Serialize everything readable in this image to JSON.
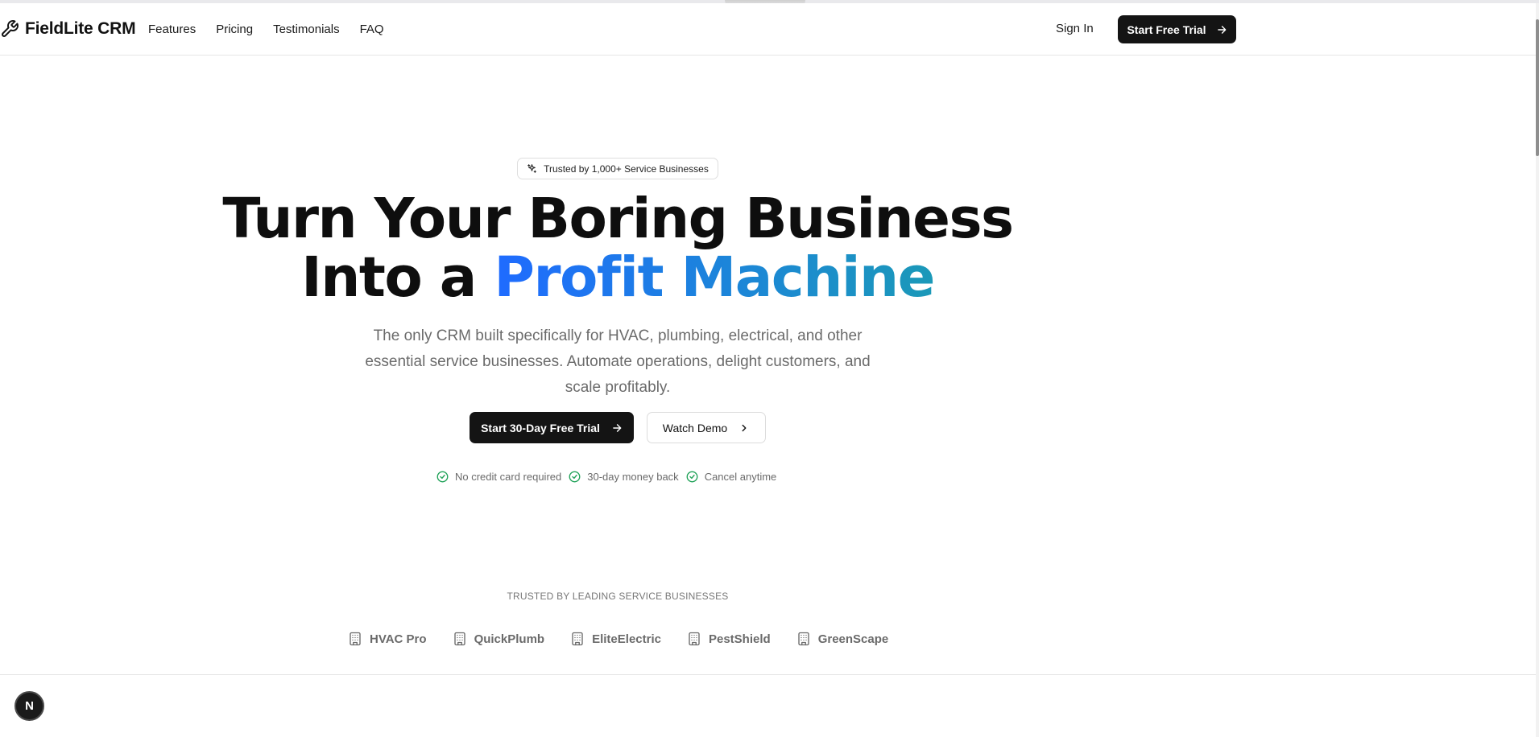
{
  "header": {
    "brand_name": "FieldLite CRM",
    "brand_icon": "wrench-icon",
    "nav_links": [
      "Features",
      "Pricing",
      "Testimonials",
      "FAQ"
    ],
    "sign_in_label": "Sign In",
    "cta_label": "Start Free Trial"
  },
  "hero": {
    "badge_text": "Trusted by 1,000+ Service Businesses",
    "headline_line1": "Turn Your Boring Business",
    "headline_line2_prefix": "Into a ",
    "headline_highlight": "Profit Machine",
    "subtext": "The only CRM built specifically for HVAC, plumbing, electrical, and other essential service businesses. Automate operations, delight customers, and scale profitably.",
    "primary_cta": "Start 30-Day Free Trial",
    "secondary_cta": "Watch Demo",
    "checks": [
      "No credit card required",
      "30-day money back",
      "Cancel anytime"
    ]
  },
  "trusted": {
    "label": "TRUSTED BY LEADING SERVICE BUSINESSES",
    "logos": [
      "HVAC Pro",
      "QuickPlumb",
      "EliteElectric",
      "PestShield",
      "GreenScape"
    ]
  },
  "floating_badge": "N",
  "colors": {
    "primary_dark": "#141414",
    "gradient_start": "#1f6bff",
    "gradient_end": "#1b99b8",
    "check_green": "#22a35a"
  }
}
